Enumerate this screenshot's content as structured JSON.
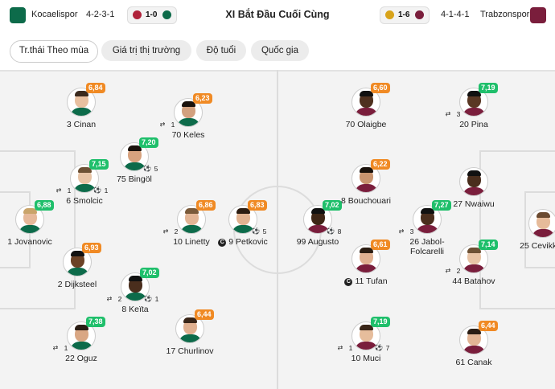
{
  "header": {
    "home_team": "Kocaelispor",
    "home_formation": "4-2-3-1",
    "home_score": "1-0",
    "title": "XI Bắt Đầu Cuối Cùng",
    "away_score": "1-6",
    "away_formation": "4-1-4-1",
    "away_team": "Trabzonspor"
  },
  "tabs": [
    "Tr.thái Theo mùa",
    "Giá trị thị trường",
    "Độ tuổi",
    "Quốc gia"
  ],
  "colors": {
    "rating_green": "#1fbf6b",
    "rating_orange": "#f08a24",
    "home": "#0d6b4a",
    "away": "#7a1e3c"
  },
  "home_players": [
    {
      "num": "1",
      "name": "Jovanovic",
      "rating": "6,88",
      "rc": "green",
      "hair": "#c9a46a",
      "skin": "#e6b99a"
    },
    {
      "num": "2",
      "name": "Dijksteel",
      "rating": "6,93",
      "rc": "orange",
      "hair": "#111",
      "skin": "#6b4226"
    },
    {
      "num": "3",
      "name": "Cinan",
      "rating": "6,84",
      "rc": "orange",
      "hair": "#3b2a1e",
      "skin": "#e8c0a0"
    },
    {
      "num": "6",
      "name": "Smolcic",
      "rating": "7,15",
      "rc": "green",
      "hair": "#6d5135",
      "skin": "#e8c4a6",
      "badge1": "1",
      "badge2": "1"
    },
    {
      "num": "22",
      "name": "Oguz",
      "rating": "7,38",
      "rc": "green",
      "hair": "#2a1d14",
      "skin": "#d9a784",
      "badge1": "1"
    },
    {
      "num": "8",
      "name": "Keïta",
      "rating": "7,02",
      "rc": "green",
      "hair": "#111",
      "skin": "#4a2e1d",
      "badge1": "2",
      "badge2": "1"
    },
    {
      "num": "75",
      "name": "Bingöl",
      "rating": "7,20",
      "rc": "green",
      "hair": "#1a120c",
      "skin": "#d7a27e",
      "badge2": "5"
    },
    {
      "num": "70",
      "name": "Keles",
      "rating": "6,23",
      "rc": "orange",
      "hair": "#1a120c",
      "skin": "#d3a17f",
      "badge1": "1"
    },
    {
      "num": "10",
      "name": "Linetty",
      "rating": "6,86",
      "rc": "orange",
      "hair": "#7a5a3a",
      "skin": "#e3b595",
      "badge1": "2"
    },
    {
      "num": "17",
      "name": "Churlinov",
      "rating": "6,44",
      "rc": "orange",
      "hair": "#3a2618",
      "skin": "#e0b090"
    },
    {
      "num": "9",
      "name": "Petkovic",
      "rating": "6,83",
      "rc": "orange",
      "hair": "#2c1d12",
      "skin": "#e2b391",
      "badge2": "5",
      "captain": "C"
    }
  ],
  "away_players": [
    {
      "num": "70",
      "name": "Olaigbe",
      "rating": "6,60",
      "rc": "orange",
      "hair": "#111",
      "skin": "#4f311f"
    },
    {
      "num": "20",
      "name": "Pina",
      "rating": "7,19",
      "rc": "green",
      "hair": "#111",
      "skin": "#5a3824",
      "badge1": "3"
    },
    {
      "num": "8",
      "name": "Bouchouari",
      "rating": "6,22",
      "rc": "orange",
      "hair": "#1b120c",
      "skin": "#c9946f"
    },
    {
      "num": "27",
      "name": "Nwaiwu",
      "rating": "",
      "rc": "green",
      "hair": "#111",
      "skin": "#4a2e1d"
    },
    {
      "num": "99",
      "name": "Augusto",
      "rating": "7,02",
      "rc": "green",
      "hair": "#111",
      "skin": "#3e2616",
      "badge2": "8"
    },
    {
      "num": "26",
      "name": "Jabol-\nFolcarelli",
      "rating": "7,27",
      "rc": "green",
      "hair": "#111",
      "skin": "#4a2e1d",
      "badge1": "3"
    },
    {
      "num": "25",
      "name": "Cevikkan",
      "rating": "",
      "rc": "green",
      "hair": "#6b4a30",
      "skin": "#e6bb9a"
    },
    {
      "num": "11",
      "name": "Tufan",
      "rating": "6,61",
      "rc": "orange",
      "hair": "#2c1d12",
      "skin": "#e0b090",
      "captain": "C"
    },
    {
      "num": "44",
      "name": "Batahov",
      "rating": "7,14",
      "rc": "green",
      "hair": "#6d5135",
      "skin": "#e8c4a6",
      "badge1": "2"
    },
    {
      "num": "10",
      "name": "Muci",
      "rating": "7,19",
      "rc": "green",
      "hair": "#3a2618",
      "skin": "#e6bd9c",
      "badge1": "1",
      "badge2": "7"
    },
    {
      "num": "61",
      "name": "Canak",
      "rating": "6,44",
      "rc": "orange",
      "hair": "#2a1d14",
      "skin": "#e3b595"
    }
  ]
}
